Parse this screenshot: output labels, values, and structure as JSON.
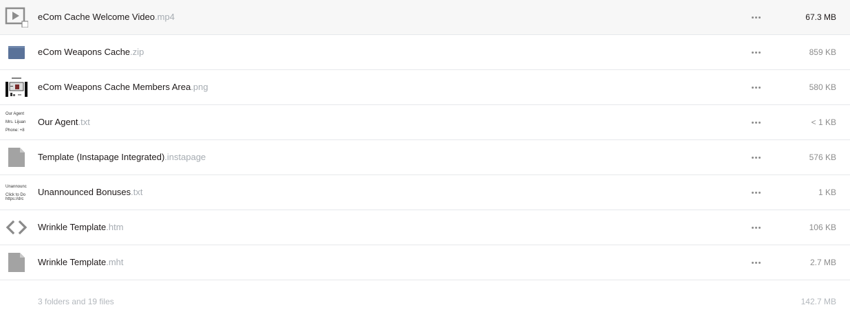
{
  "files": [
    {
      "name": "eCom Cache Welcome Video",
      "ext": ".mp4",
      "size": "67.3 MB",
      "icon": "video-file-icon",
      "hover": true
    },
    {
      "name": "eCom Weapons Cache",
      "ext": ".zip",
      "size": "859 KB",
      "icon": "zip-folder-icon"
    },
    {
      "name": "eCom Weapons Cache Members Area",
      "ext": ".png",
      "size": "580 KB",
      "icon": "image-thumbnail-icon"
    },
    {
      "name": "Our Agent",
      "ext": ".txt",
      "size": "< 1 KB",
      "icon": "text-thumbnail-icon",
      "preview": [
        "Our Agent",
        "Mrs. Lijuan",
        "Phone: +8"
      ]
    },
    {
      "name": "Template (Instapage Integrated)",
      "ext": ".instapage",
      "size": "576 KB",
      "icon": "generic-file-icon"
    },
    {
      "name": "Unannounced Bonuses",
      "ext": ".txt",
      "size": "1 KB",
      "icon": "text-thumbnail-icon",
      "preview": [
        "Unannounc",
        "Click to Do",
        "https://drc"
      ]
    },
    {
      "name": "Wrinkle Template",
      "ext": ".htm",
      "size": "106 KB",
      "icon": "code-file-icon"
    },
    {
      "name": "Wrinkle Template",
      "ext": ".mht",
      "size": "2.7 MB",
      "icon": "generic-file-icon"
    }
  ],
  "footer": {
    "count": "3 folders and 19 files",
    "total": "142.7 MB"
  },
  "colors": {
    "zip": "#5a7299",
    "generic": "#a3a3a3",
    "code": "#8a8a8a",
    "video": "#8c8c8c"
  }
}
